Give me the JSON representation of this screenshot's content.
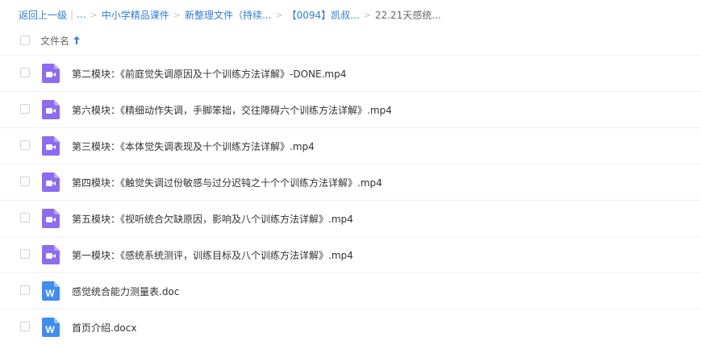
{
  "breadcrumb": {
    "back": "返回上一级",
    "ellipsis": "...",
    "items": [
      "中小学精品课件",
      "新整理文件（持续...",
      "【0094】凯叔...",
      "22.21天感统..."
    ]
  },
  "header": {
    "column_name": "文件名"
  },
  "files": [
    {
      "name": "第二模块：《前庭觉失调原因及十个训练方法详解》-DONE.mp4",
      "type": "video"
    },
    {
      "name": "第六模块：《精细动作失调，手脚笨拙，交往障碍六个训练方法详解》.mp4",
      "type": "video"
    },
    {
      "name": "第三模块：《本体觉失调表现及十个训练方法详解》.mp4",
      "type": "video"
    },
    {
      "name": "第四模块：《触觉失调过份敏感与过分迟钝之十个个训练方法详解》.mp4",
      "type": "video"
    },
    {
      "name": "第五模块：《视听统合欠缺原因，影响及八个训练方法详解》.mp4",
      "type": "video"
    },
    {
      "name": "第一模块：《感统系统测评，训练目标及八个训练方法详解》.mp4",
      "type": "video"
    },
    {
      "name": "感觉统合能力测量表.doc",
      "type": "word"
    },
    {
      "name": "首页介绍.docx",
      "type": "word"
    }
  ],
  "colors": {
    "link": "#2f7de1",
    "video_icon": "#8c6cf0",
    "word_icon": "#3f8cf2"
  },
  "icons": {
    "video": "video-file-icon",
    "word": "word-file-icon",
    "sort": "sort-ascending-icon"
  },
  "word_icon_letter": "W"
}
